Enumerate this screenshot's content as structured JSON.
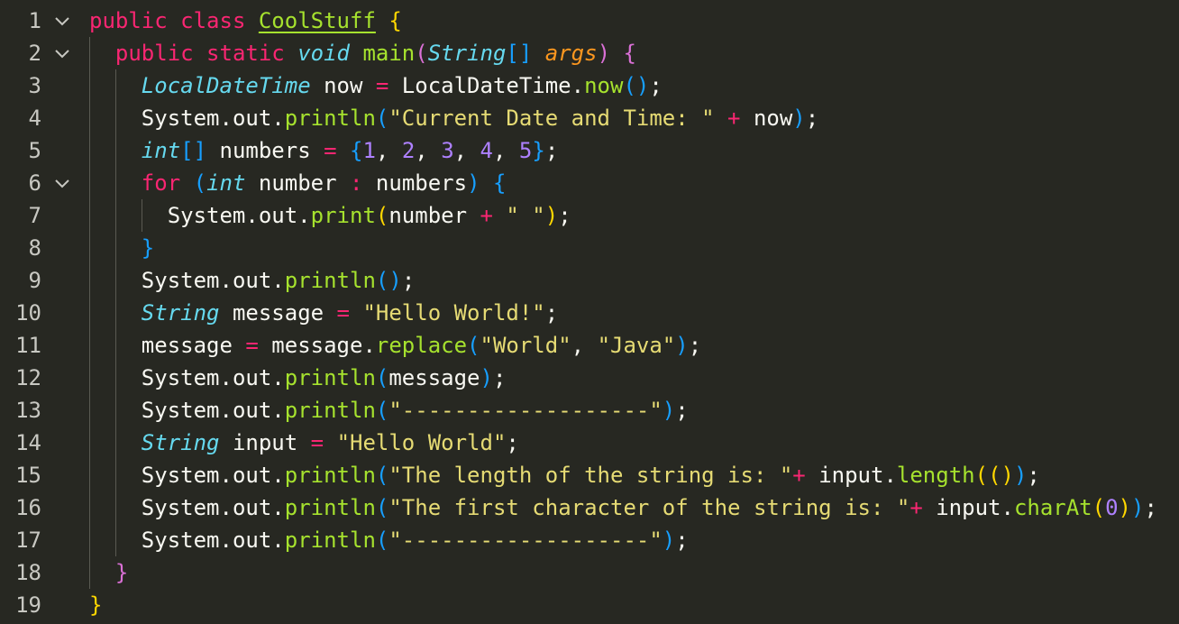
{
  "editor": {
    "language": "java",
    "lines": [
      {
        "number": "1",
        "foldable": true,
        "indent": 0,
        "tokens": [
          [
            "public",
            "k"
          ],
          [
            " ",
            "pl"
          ],
          [
            "class",
            "k"
          ],
          [
            " ",
            "pl"
          ],
          [
            "CoolStuff",
            "cls"
          ],
          [
            " ",
            "pl"
          ],
          [
            "{",
            "b1"
          ]
        ]
      },
      {
        "number": "2",
        "foldable": true,
        "indent": 1,
        "tokens": [
          [
            "public",
            "k"
          ],
          [
            " ",
            "pl"
          ],
          [
            "static",
            "k"
          ],
          [
            " ",
            "pl"
          ],
          [
            "void",
            "t"
          ],
          [
            " ",
            "pl"
          ],
          [
            "main",
            "fn"
          ],
          [
            "(",
            "b2"
          ],
          [
            "String",
            "t"
          ],
          [
            "[]",
            "b3"
          ],
          [
            " ",
            "pl"
          ],
          [
            "args",
            "prm"
          ],
          [
            ")",
            "b2"
          ],
          [
            " ",
            "pl"
          ],
          [
            "{",
            "b2"
          ]
        ]
      },
      {
        "number": "3",
        "foldable": false,
        "indent": 2,
        "tokens": [
          [
            "LocalDateTime",
            "t"
          ],
          [
            " now ",
            "pl"
          ],
          [
            "=",
            "op"
          ],
          [
            " LocalDateTime.",
            "pl"
          ],
          [
            "now",
            "fn"
          ],
          [
            "()",
            "b3"
          ],
          [
            ";",
            "pl"
          ]
        ]
      },
      {
        "number": "4",
        "foldable": false,
        "indent": 2,
        "tokens": [
          [
            "System.out.",
            "pl"
          ],
          [
            "println",
            "fn"
          ],
          [
            "(",
            "b3"
          ],
          [
            "\"Current Date and Time: \"",
            "s"
          ],
          [
            " ",
            "pl"
          ],
          [
            "+",
            "op"
          ],
          [
            " now",
            "pl"
          ],
          [
            ")",
            "b3"
          ],
          [
            ";",
            "pl"
          ]
        ]
      },
      {
        "number": "5",
        "foldable": false,
        "indent": 2,
        "tokens": [
          [
            "int",
            "t"
          ],
          [
            "[]",
            "b3"
          ],
          [
            " numbers ",
            "pl"
          ],
          [
            "=",
            "op"
          ],
          [
            " ",
            "pl"
          ],
          [
            "{",
            "b3"
          ],
          [
            "1",
            "n"
          ],
          [
            ", ",
            "pl"
          ],
          [
            "2",
            "n"
          ],
          [
            ", ",
            "pl"
          ],
          [
            "3",
            "n"
          ],
          [
            ", ",
            "pl"
          ],
          [
            "4",
            "n"
          ],
          [
            ", ",
            "pl"
          ],
          [
            "5",
            "n"
          ],
          [
            "}",
            "b3"
          ],
          [
            ";",
            "pl"
          ]
        ]
      },
      {
        "number": "6",
        "foldable": true,
        "indent": 2,
        "tokens": [
          [
            "for",
            "k"
          ],
          [
            " ",
            "pl"
          ],
          [
            "(",
            "b3"
          ],
          [
            "int",
            "t"
          ],
          [
            " number ",
            "pl"
          ],
          [
            ":",
            "op"
          ],
          [
            " numbers",
            "pl"
          ],
          [
            ")",
            "b3"
          ],
          [
            " ",
            "pl"
          ],
          [
            "{",
            "b3"
          ]
        ]
      },
      {
        "number": "7",
        "foldable": false,
        "indent": 3,
        "tokens": [
          [
            "System.out.",
            "pl"
          ],
          [
            "print",
            "fn"
          ],
          [
            "(",
            "b1"
          ],
          [
            "number ",
            "pl"
          ],
          [
            "+",
            "op"
          ],
          [
            " ",
            "pl"
          ],
          [
            "\" \"",
            "s"
          ],
          [
            ")",
            "b1"
          ],
          [
            ";",
            "pl"
          ]
        ]
      },
      {
        "number": "8",
        "foldable": false,
        "indent": 2,
        "tokens": [
          [
            "}",
            "b3"
          ]
        ]
      },
      {
        "number": "9",
        "foldable": false,
        "indent": 2,
        "tokens": [
          [
            "System.out.",
            "pl"
          ],
          [
            "println",
            "fn"
          ],
          [
            "()",
            "b3"
          ],
          [
            ";",
            "pl"
          ]
        ]
      },
      {
        "number": "10",
        "foldable": false,
        "indent": 2,
        "tokens": [
          [
            "String",
            "t"
          ],
          [
            " message ",
            "pl"
          ],
          [
            "=",
            "op"
          ],
          [
            " ",
            "pl"
          ],
          [
            "\"Hello World!\"",
            "s"
          ],
          [
            ";",
            "pl"
          ]
        ]
      },
      {
        "number": "11",
        "foldable": false,
        "indent": 2,
        "tokens": [
          [
            "message ",
            "pl"
          ],
          [
            "=",
            "op"
          ],
          [
            " message.",
            "pl"
          ],
          [
            "replace",
            "fn"
          ],
          [
            "(",
            "b3"
          ],
          [
            "\"World\"",
            "s"
          ],
          [
            ", ",
            "pl"
          ],
          [
            "\"Java\"",
            "s"
          ],
          [
            ")",
            "b3"
          ],
          [
            ";",
            "pl"
          ]
        ]
      },
      {
        "number": "12",
        "foldable": false,
        "indent": 2,
        "tokens": [
          [
            "System.out.",
            "pl"
          ],
          [
            "println",
            "fn"
          ],
          [
            "(",
            "b3"
          ],
          [
            "message",
            "pl"
          ],
          [
            ")",
            "b3"
          ],
          [
            ";",
            "pl"
          ]
        ]
      },
      {
        "number": "13",
        "foldable": false,
        "indent": 2,
        "tokens": [
          [
            "System.out.",
            "pl"
          ],
          [
            "println",
            "fn"
          ],
          [
            "(",
            "b3"
          ],
          [
            "\"-------------------\"",
            "s"
          ],
          [
            ")",
            "b3"
          ],
          [
            ";",
            "pl"
          ]
        ]
      },
      {
        "number": "14",
        "foldable": false,
        "indent": 2,
        "tokens": [
          [
            "String",
            "t"
          ],
          [
            " input ",
            "pl"
          ],
          [
            "=",
            "op"
          ],
          [
            " ",
            "pl"
          ],
          [
            "\"Hello World\"",
            "s"
          ],
          [
            ";",
            "pl"
          ]
        ]
      },
      {
        "number": "15",
        "foldable": false,
        "indent": 2,
        "tokens": [
          [
            "System.out.",
            "pl"
          ],
          [
            "println",
            "fn"
          ],
          [
            "(",
            "b3"
          ],
          [
            "\"The length of the string is: \"",
            "s"
          ],
          [
            "+",
            "op"
          ],
          [
            " input.",
            "pl"
          ],
          [
            "length",
            "fn"
          ],
          [
            "(",
            "b1"
          ],
          [
            "()",
            "b1"
          ],
          [
            ")",
            "b3"
          ],
          [
            ";",
            "pl"
          ]
        ]
      },
      {
        "number": "16",
        "foldable": false,
        "indent": 2,
        "tokens": [
          [
            "System.out.",
            "pl"
          ],
          [
            "println",
            "fn"
          ],
          [
            "(",
            "b3"
          ],
          [
            "\"The first character of the string is: \"",
            "s"
          ],
          [
            "+",
            "op"
          ],
          [
            " input.",
            "pl"
          ],
          [
            "charAt",
            "fn"
          ],
          [
            "(",
            "b1"
          ],
          [
            "0",
            "n"
          ],
          [
            ")",
            "b1"
          ],
          [
            ")",
            "b3"
          ],
          [
            ";",
            "pl"
          ]
        ]
      },
      {
        "number": "17",
        "foldable": false,
        "indent": 2,
        "tokens": [
          [
            "System.out.",
            "pl"
          ],
          [
            "println",
            "fn"
          ],
          [
            "(",
            "b3"
          ],
          [
            "\"-------------------\"",
            "s"
          ],
          [
            ")",
            "b3"
          ],
          [
            ";",
            "pl"
          ]
        ]
      },
      {
        "number": "18",
        "foldable": false,
        "indent": 1,
        "tokens": [
          [
            "}",
            "b2"
          ]
        ]
      },
      {
        "number": "19",
        "foldable": false,
        "indent": 0,
        "tokens": [
          [
            "}",
            "b1"
          ]
        ]
      }
    ]
  },
  "icons": {
    "fold": "chevron-down-icon"
  },
  "colors": {
    "background": "#272822",
    "line_number": "#c8c8c2",
    "keyword": "#f92672",
    "type": "#66d9ef",
    "function": "#a6e22e",
    "string": "#e6db74",
    "number": "#ae81ff",
    "parameter": "#fd971f",
    "bracket_gold": "#ffd700",
    "bracket_orchid": "#da70d6",
    "bracket_blue": "#179fff"
  }
}
